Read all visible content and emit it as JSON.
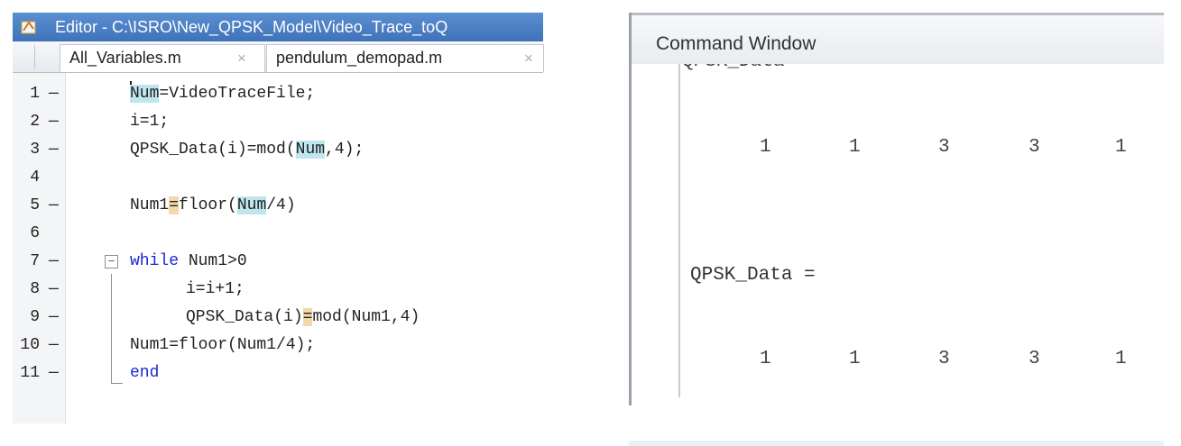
{
  "editor": {
    "title": "Editor - C:\\ISRO\\New_QPSK_Model\\Video_Trace_toQ",
    "tabs": [
      {
        "label": "All_Variables.m",
        "close": "×"
      },
      {
        "label": "pendulum_demopad.m",
        "close": "×"
      }
    ],
    "lines": [
      {
        "num": "1",
        "mark": "—"
      },
      {
        "num": "2",
        "mark": "—"
      },
      {
        "num": "3",
        "mark": "—"
      },
      {
        "num": "4",
        "mark": ""
      },
      {
        "num": "5",
        "mark": "—"
      },
      {
        "num": "6",
        "mark": ""
      },
      {
        "num": "7",
        "mark": "—"
      },
      {
        "num": "8",
        "mark": "—"
      },
      {
        "num": "9",
        "mark": "—"
      },
      {
        "num": "10",
        "mark": "—"
      },
      {
        "num": "11",
        "mark": "—"
      }
    ],
    "code": {
      "l1_var": "Num",
      "l1_rest": "=VideoTraceFile;",
      "l2": "i=1;",
      "l3_a": "QPSK_Data(i)=mod(",
      "l3_var": "Num",
      "l3_b": ",4);",
      "l5_a": "Num1",
      "l5_eq": "=",
      "l5_b": "floor(",
      "l5_var": "Num",
      "l5_c": "/4)",
      "l7_kw": "while",
      "l7_rest": " Num1>0",
      "l8": "i=i+1;",
      "l9_a": "QPSK_Data(i)",
      "l9_eq": "=",
      "l9_b": "mod(Num1,4)",
      "l10": "Num1=floor(Num1/4);",
      "l11_kw": "end"
    },
    "fold_symbol": "−"
  },
  "command_window": {
    "title": "Command Window",
    "cut_text": "QPSK_Data",
    "values_row_1": [
      "1",
      "1",
      "3",
      "3",
      "1"
    ],
    "variable_line": "QPSK_Data =",
    "values_row_2": [
      "1",
      "1",
      "3",
      "3",
      "1"
    ]
  },
  "icons": {
    "app": "matlab-editor-icon",
    "fold": "fold-collapse-icon",
    "tab_close": "close-icon"
  }
}
